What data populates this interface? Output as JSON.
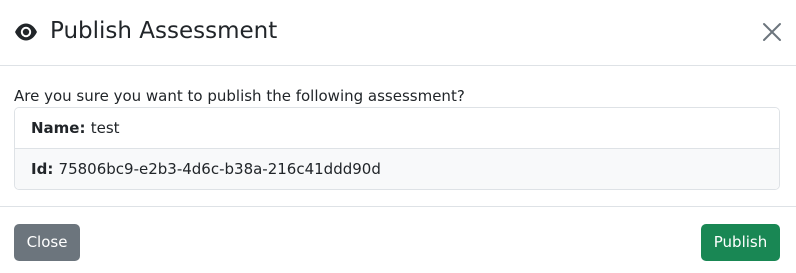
{
  "modal": {
    "title": "Publish Assessment",
    "title_icon": "eye-icon",
    "close_icon": "close-icon"
  },
  "body": {
    "prompt": "Are you sure you want to publish the following assessment?",
    "fields": [
      {
        "label": "Name:",
        "value": "test"
      },
      {
        "label": "Id:",
        "value": "75806bc9-e2b3-4d6c-b38a-216c41ddd90d"
      }
    ]
  },
  "footer": {
    "close_label": "Close",
    "publish_label": "Publish"
  },
  "colors": {
    "secondary": "#6c757d",
    "success": "#198754",
    "border": "#dee2e6",
    "striped_row": "#f8f9fa"
  }
}
